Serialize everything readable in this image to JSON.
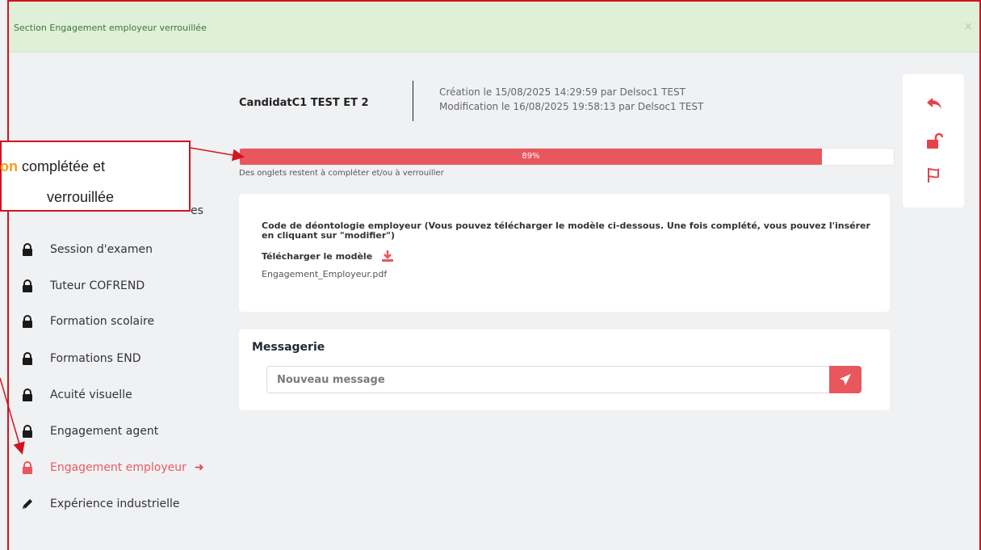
{
  "alert": {
    "text": "Section Engagement employeur verrouillée",
    "close": "×"
  },
  "header": {
    "name": "CandidatC1 TEST ET 2",
    "created": "Création le 15/08/2025 14:29:59 par Delsoc1 TEST",
    "modified": "Modification le 16/08/2025 19:58:13 par Delsoc1 TEST"
  },
  "progress": {
    "value": 0.89,
    "label": "89%",
    "note": "Des onglets restent à compléter et/ou à verrouiller"
  },
  "callout": {
    "highlight": "ion",
    "line1_rest": " complétée et",
    "line2": "verrouillée",
    "hidden_suffix": "es"
  },
  "sidebar": {
    "items": [
      {
        "label": "Session d'examen",
        "icon": "lock-icon"
      },
      {
        "label": "Tuteur COFREND",
        "icon": "lock-icon"
      },
      {
        "label": "Formation scolaire",
        "icon": "lock-icon"
      },
      {
        "label": "Formations END",
        "icon": "lock-icon"
      },
      {
        "label": "Acuité visuelle",
        "icon": "lock-icon"
      },
      {
        "label": "Engagement agent",
        "icon": "lock-icon"
      },
      {
        "label": "Engagement employeur",
        "icon": "lock-icon",
        "active": true
      },
      {
        "label": "Expérience industrielle",
        "icon": "pencil-icon"
      }
    ]
  },
  "document": {
    "title": "Code de déontologie employeur (Vous pouvez télécharger le modèle ci-dessous. Une fois complété, vous pouvez l'insérer en cliquant sur \"modifier\")",
    "download_label": "Télécharger le modèle",
    "file_name": "Engagement_Employeur.pdf"
  },
  "messaging": {
    "title": "Messagerie",
    "placeholder": "Nouveau message"
  },
  "actions": [
    "reply-icon",
    "unlock-icon",
    "flag-icon"
  ],
  "colors": {
    "accent": "#e8565e",
    "annotation": "#d7111d",
    "highlight": "#f0a020",
    "alert_bg": "#dff0d8"
  }
}
